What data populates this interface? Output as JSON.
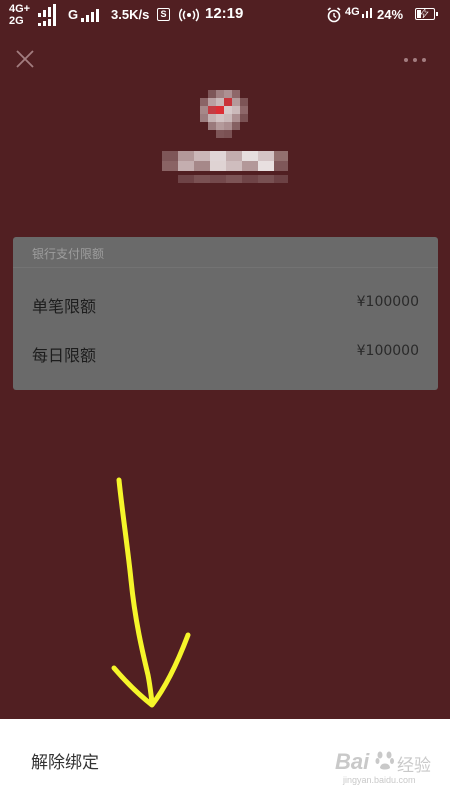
{
  "status_bar": {
    "network_top": "4G+",
    "network_bottom": "2G",
    "network_g": "G",
    "speed": "3.5K/s",
    "sim_badge": "S",
    "time": "12:19",
    "network_right": "4G",
    "battery_percent": "24%",
    "battery_level": 0.24,
    "icons": [
      "signal-icon",
      "hotspot-icon",
      "alarm-icon",
      "battery-icon",
      "charging-icon"
    ]
  },
  "toolbar": {
    "close_icon": "close-icon",
    "more_icon": "more-options-icon"
  },
  "bank": {
    "logo_icon": "bank-logo-pixelated"
  },
  "limit_card": {
    "title": "银行支付限额",
    "rows": [
      {
        "label": "单笔限额",
        "value": "¥100000"
      },
      {
        "label": "每日限额",
        "value": "¥100000"
      }
    ]
  },
  "bottom_sheet": {
    "unbind_label": "解除绑定"
  },
  "watermark": {
    "brand": "Bai",
    "brand_cn": "经验",
    "url": "jingyan.baidu.com"
  },
  "colors": {
    "background": "#511f22",
    "card": "#6a6a6a",
    "annotation_arrow": "#f5f52a",
    "sheet": "#ffffff"
  }
}
